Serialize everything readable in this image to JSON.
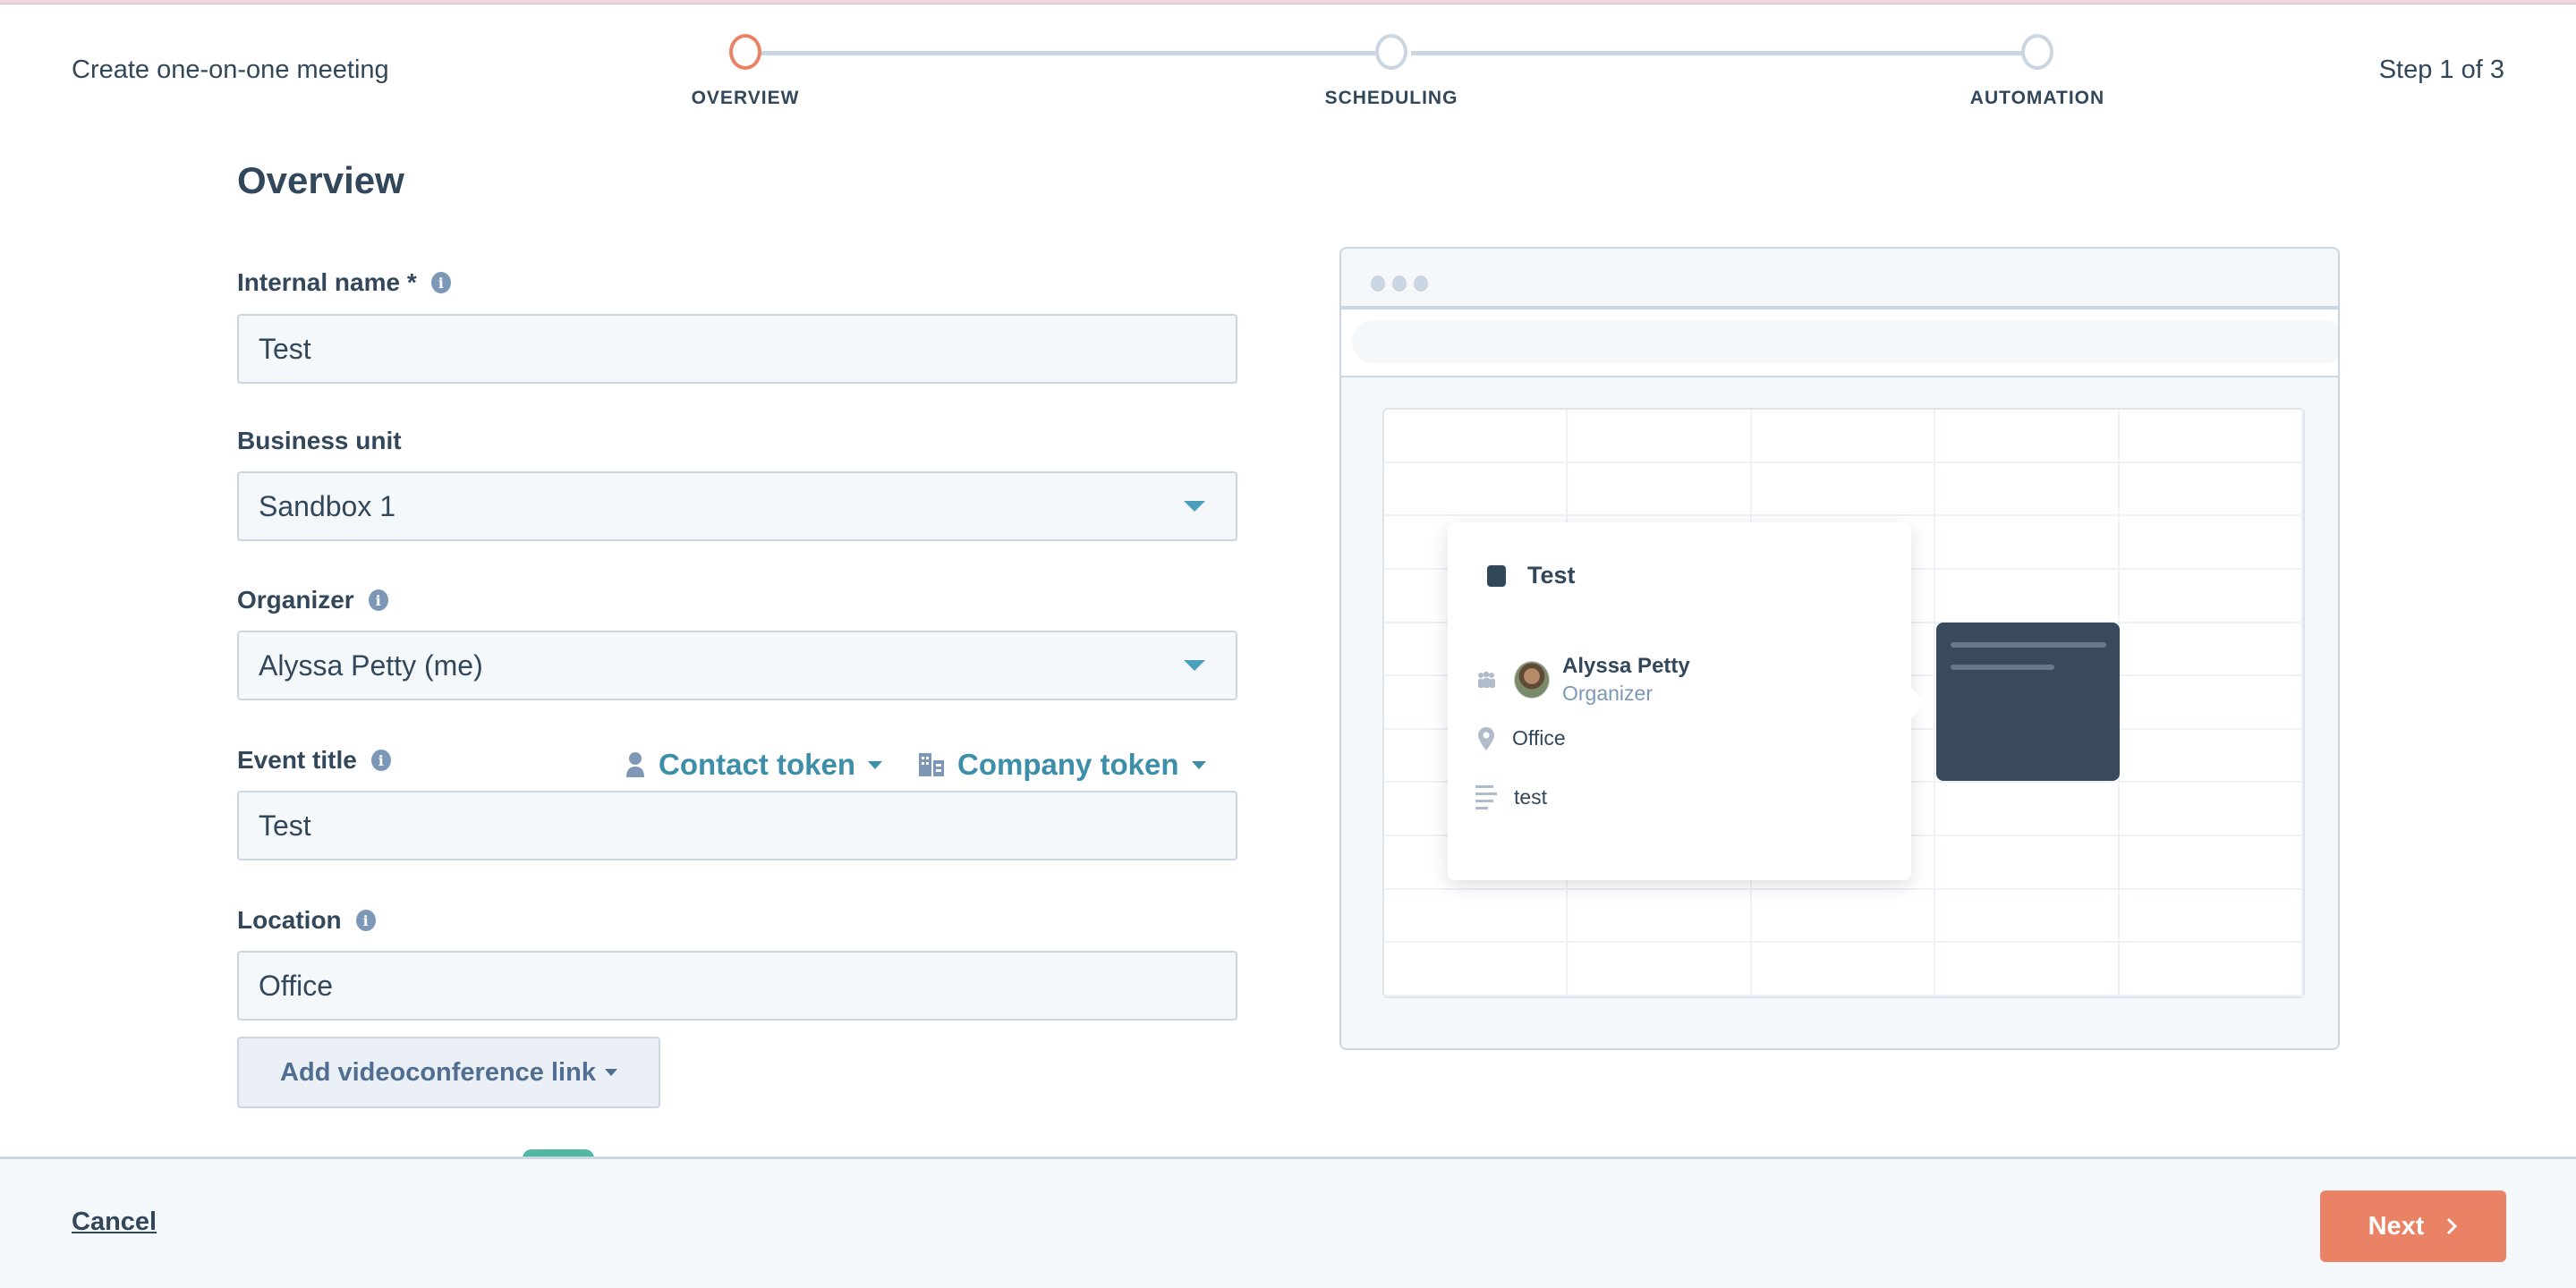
{
  "header": {
    "title": "Create one-on-one meeting",
    "step_counter": "Step 1 of 3",
    "steps": [
      {
        "label": "OVERVIEW",
        "state": "active"
      },
      {
        "label": "SCHEDULING",
        "state": "inactive"
      },
      {
        "label": "AUTOMATION",
        "state": "inactive"
      }
    ]
  },
  "form": {
    "heading": "Overview",
    "internal_name": {
      "label": "Internal name *",
      "value": "Test",
      "info_icon": "info-icon"
    },
    "business_unit": {
      "label": "Business unit",
      "value": "Sandbox 1"
    },
    "organizer": {
      "label": "Organizer",
      "value": "Alyssa Petty (me)",
      "info_icon": "info-icon"
    },
    "event_title": {
      "label": "Event title",
      "value": "Test",
      "contact_token": "Contact token",
      "company_token": "Company token"
    },
    "location": {
      "label": "Location",
      "value": "Office"
    },
    "videoconference_button": "Add videoconference link"
  },
  "preview": {
    "popover": {
      "title": "Test",
      "organizer_name": "Alyssa Petty",
      "organizer_role": "Organizer",
      "location": "Office",
      "description": "test"
    }
  },
  "footer": {
    "cancel_label": "Cancel",
    "next_label": "Next"
  },
  "colors": {
    "accent": "#ea8266",
    "link": "#3d8ea8",
    "text": "#33475b",
    "border": "#cbd6e2"
  }
}
